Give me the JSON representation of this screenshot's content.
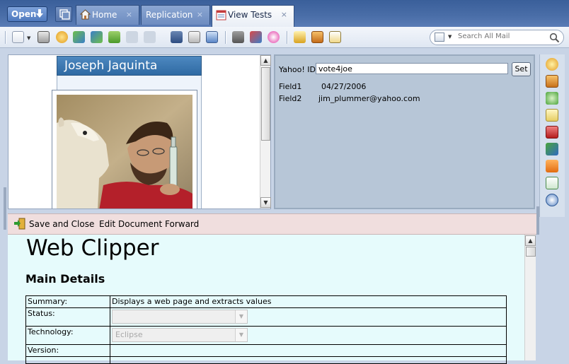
{
  "tabbar": {
    "open_label": "Open",
    "tabs": [
      {
        "label": "Home",
        "close": "×"
      },
      {
        "label": "Replication",
        "close": "×"
      },
      {
        "label": "View Tests",
        "close": "×"
      }
    ]
  },
  "toolbar": {
    "search_placeholder": "Search All Mail"
  },
  "contact": {
    "name": "Joseph Jaquinta"
  },
  "fields": {
    "yahoo_label": "Yahoo! ID",
    "yahoo_value": "vote4joe",
    "set_label": "Set",
    "field1_label": "Field1",
    "field1_value": "04/27/2006",
    "field2_label": "Field2",
    "field2_value": "jim_plummer@yahoo.com"
  },
  "docbar": {
    "save_close": "Save and Close",
    "edit": "Edit Document",
    "forward": "Forward"
  },
  "document": {
    "title": "Web Clipper",
    "section": "Main Details",
    "rows": [
      {
        "label": "Summary:",
        "value": "Displays a web page and extracts values"
      },
      {
        "label": "Status:",
        "value": ""
      },
      {
        "label": "Technology:",
        "value": "Eclipse"
      },
      {
        "label": "Version:",
        "value": ""
      }
    ]
  },
  "colors": {
    "tabbar": "#4a6ea8",
    "doc_background": "#e6fbfc",
    "docbar_background": "#f0dede",
    "fields_background": "#b7c6d7",
    "name_header": "#3e79b2"
  }
}
